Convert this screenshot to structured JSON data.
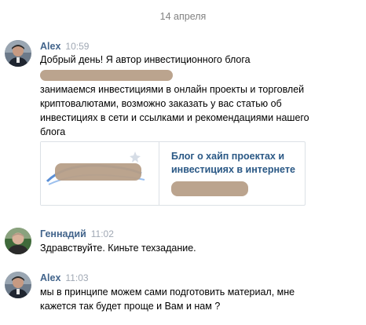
{
  "date_separator": "14 апреля",
  "messages": [
    {
      "author": "Alex",
      "time": "10:59",
      "avatar_icon": "user-photo-icon",
      "text_lines": [
        "Добрый день! Я автор инвестиционного блога",
        "занимаемся инвестициями в онлайн проекты и торговлей",
        "криптовалютами, возможно заказать у вас статью об",
        "инвестициях в сети и ссылками и рекомендациями нашего",
        "блога"
      ],
      "link_card": {
        "title_lines": [
          "Блог о хайп проектах и",
          "инвестициях в интернете"
        ]
      }
    },
    {
      "author": "Геннадий",
      "time": "11:02",
      "avatar_icon": "user-photo-icon",
      "text_lines": [
        "Здравствуйте. Киньте техзадание."
      ]
    },
    {
      "author": "Alex",
      "time": "11:03",
      "avatar_icon": "user-photo-icon",
      "text_lines": [
        "мы в принципе можем сами подготовить материал, мне",
        "кажется так будет проще и Вам и нам ?"
      ]
    }
  ],
  "colors": {
    "author": "#42648b",
    "time": "#a0a8b4",
    "link_title": "#2a5885",
    "date": "#828282",
    "redaction": "#b79f88"
  }
}
